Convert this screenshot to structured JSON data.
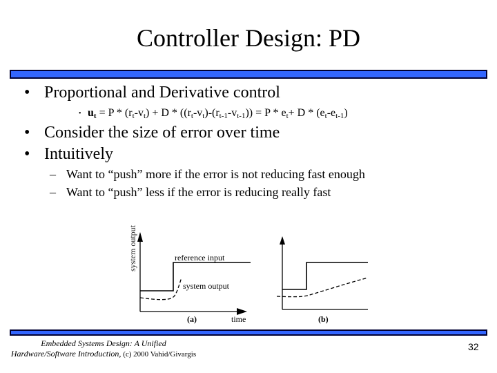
{
  "slide": {
    "title": "Controller Design: PD",
    "bullets": [
      {
        "level": 1,
        "text": "Proportional and Derivative control"
      },
      {
        "level": 2,
        "formula": {
          "lhs": "u",
          "lhs_sub": "t",
          "parts": [
            " = P * (r",
            "t",
            "-v",
            "t",
            ") + D * ((r",
            "t",
            "-v",
            "t",
            ")-(r",
            "t-1",
            "-v",
            "t-1",
            ")) = P * e",
            "t",
            "+ D * (e",
            "t",
            "-e",
            "t-1",
            ")"
          ]
        }
      },
      {
        "level": 1,
        "text": "Consider the size of error over time"
      },
      {
        "level": 1,
        "text": "Intuitively"
      },
      {
        "level": 3,
        "text": "Want to “push” more if the error is not reducing fast enough"
      },
      {
        "level": 3,
        "text": "Want to “push” less if the error is reducing really fast"
      }
    ],
    "bullet_glyph": "•",
    "dash_glyph": "–",
    "page_number": "32",
    "footer": {
      "line1": "Embedded Systems Design: A Unified",
      "line2_italic": "Hardware/Software Introduction,",
      "line2_plain": " (c) 2000 Vahid/Givargis"
    },
    "colors": {
      "bar_fill": "#3366ff",
      "bar_border": "#000033"
    }
  },
  "figure": {
    "panel_a": {
      "y_axis_label": "system output",
      "x_axis_label": "time",
      "caption": "(a)",
      "reference_label": "reference input",
      "output_label": "system output"
    },
    "panel_b": {
      "caption": "(b)"
    }
  }
}
